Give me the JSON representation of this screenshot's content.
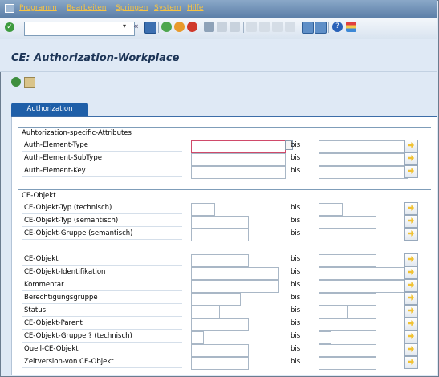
{
  "menu": {
    "items": [
      "Programm",
      "Bearbeiten",
      "Springen",
      "System",
      "Hilfe"
    ]
  },
  "toolbar": {
    "command_value": "",
    "icons": [
      "enter-icon",
      "save-icon",
      "back-icon",
      "exit-icon",
      "cancel-icon",
      "print-icon",
      "find-icon",
      "find-next-icon",
      "first-page-icon",
      "prev-page-icon",
      "next-page-icon",
      "last-page-icon",
      "new-session-icon",
      "shortcut-icon",
      "help-icon",
      "customize-layout-icon"
    ]
  },
  "page": {
    "title": "CE: Authorization-Workplace"
  },
  "tabs": [
    {
      "label": "Authorization",
      "active": true
    }
  ],
  "groups": [
    {
      "title": "Auhtorization-specific-Attributes",
      "rows": [
        {
          "label": "Auth-Element-Type",
          "from": "",
          "to": "",
          "bis": "bis"
        },
        {
          "label": "Auth-Element-SubType",
          "from": "",
          "to": "",
          "bis": "bis"
        },
        {
          "label": "Auth-Element-Key",
          "from": "",
          "to": "",
          "bis": "bis"
        }
      ]
    },
    {
      "title": "CE-Objekt",
      "rows": [
        {
          "label": "CE-Objekt-Typ (technisch)",
          "from": "",
          "to": "",
          "bis": "bis"
        },
        {
          "label": "CE-Objekt-Typ (semantisch)",
          "from": "",
          "to": "",
          "bis": "bis"
        },
        {
          "label": "CE-Objekt-Gruppe (semantisch)",
          "from": "",
          "to": "",
          "bis": "bis"
        },
        {
          "label": "CE-Objekt",
          "from": "",
          "to": "",
          "bis": "bis"
        },
        {
          "label": "CE-Objekt-Identifikation",
          "from": "",
          "to": "",
          "bis": "bis"
        },
        {
          "label": "Kommentar",
          "from": "",
          "to": "",
          "bis": "bis"
        },
        {
          "label": "Berechtigungsgruppe",
          "from": "",
          "to": "",
          "bis": "bis"
        },
        {
          "label": "Status",
          "from": "",
          "to": "",
          "bis": "bis"
        },
        {
          "label": "CE-Objekt-Parent",
          "from": "",
          "to": "",
          "bis": "bis"
        },
        {
          "label": "CE-Objekt-Gruppe ? (technisch)",
          "from": "",
          "to": "",
          "bis": "bis"
        },
        {
          "label": "Quell-CE-Objekt",
          "from": "",
          "to": "",
          "bis": "bis"
        },
        {
          "label": "Zeitversion-von CE-Objekt",
          "from": "",
          "to": "",
          "bis": "bis"
        }
      ]
    }
  ],
  "colors": {
    "menu_text": "#f6c343",
    "tab_active": "#1f5fa8",
    "background": "#dfe9f5"
  }
}
